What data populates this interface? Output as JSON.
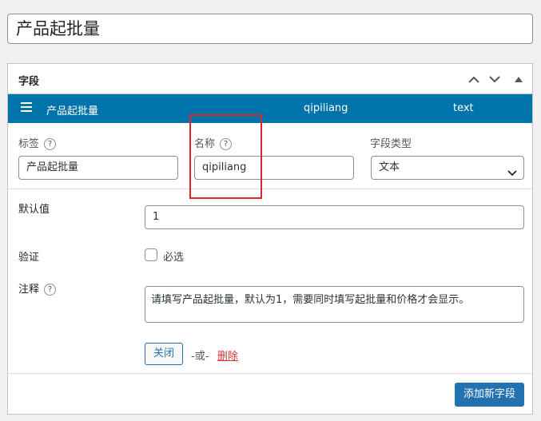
{
  "post_title": "产品起批量",
  "panel": {
    "title": "字段",
    "field_bar": {
      "label": "产品起批量",
      "name": "qipiliang",
      "type": "text"
    }
  },
  "fields": {
    "label_caption": "标签",
    "label_value": "产品起批量",
    "name_caption": "名称",
    "name_value": "qipiliang",
    "type_caption": "字段类型",
    "type_value": "文本",
    "default_caption": "默认值",
    "default_value": "1",
    "validate_caption": "验证",
    "required_label": "必选",
    "required_checked": false,
    "note_caption": "注释",
    "note_value": "请填写产品起批量，默认为1，需要同时填写起批量和价格才会显示。",
    "help_glyph": "?"
  },
  "actions": {
    "close_label": "关闭",
    "or_text": "-或-",
    "delete_label": "删除",
    "add_field_label": "添加新字段"
  },
  "colors": {
    "field_bar_bg": "#0073aa",
    "primary_button": "#2271b1",
    "delete_link": "#d63638",
    "highlight_box": "#e2242d"
  }
}
